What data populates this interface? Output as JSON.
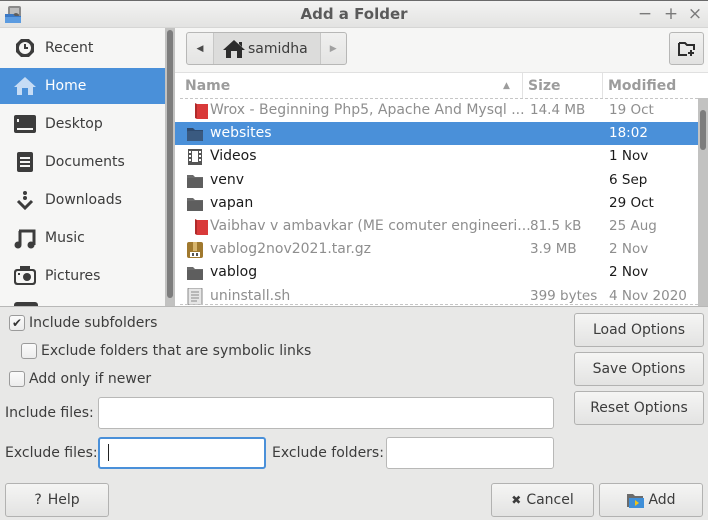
{
  "window": {
    "title": "Add a Folder",
    "controls": {
      "minimize": "−",
      "maximize": "+",
      "close": "×"
    }
  },
  "sidebar": {
    "items": [
      {
        "label": "Recent",
        "icon": "clock-icon",
        "active": false
      },
      {
        "label": "Home",
        "icon": "home-icon",
        "active": true
      },
      {
        "label": "Desktop",
        "icon": "desktop-icon",
        "active": false
      },
      {
        "label": "Documents",
        "icon": "documents-icon",
        "active": false
      },
      {
        "label": "Downloads",
        "icon": "downloads-icon",
        "active": false
      },
      {
        "label": "Music",
        "icon": "music-icon",
        "active": false
      },
      {
        "label": "Pictures",
        "icon": "camera-icon",
        "active": false
      }
    ]
  },
  "pathbar": {
    "back_arrow": "◀",
    "forward_arrow": "▶",
    "current": "samidha"
  },
  "filelist": {
    "columns": {
      "name": "Name",
      "size": "Size",
      "modified": "Modified"
    },
    "sort_indicator": "▲",
    "rows": [
      {
        "name": "Wrox - Beginning Php5, Apache And Mysql ...",
        "size": "14.4 MB",
        "modified": "19 Oct",
        "icon": "pdf-icon",
        "style": "dim"
      },
      {
        "name": "websites",
        "size": "",
        "modified": "18:02",
        "icon": "folder-icon",
        "style": "selected"
      },
      {
        "name": "Videos",
        "size": "",
        "modified": "1 Nov",
        "icon": "video-folder-icon",
        "style": "dark"
      },
      {
        "name": "venv",
        "size": "",
        "modified": "6 Sep",
        "icon": "folder-icon",
        "style": "dark"
      },
      {
        "name": "vapan",
        "size": "",
        "modified": "29 Oct",
        "icon": "folder-icon",
        "style": "dark"
      },
      {
        "name": "Vaibhav v ambavkar (ME comuter engineeri...",
        "size": "81.5 kB",
        "modified": "25 Aug",
        "icon": "pdf-icon",
        "style": "dim"
      },
      {
        "name": "vablog2nov2021.tar.gz",
        "size": "3.9 MB",
        "modified": "2 Nov",
        "icon": "archive-icon",
        "style": "dim"
      },
      {
        "name": "vablog",
        "size": "",
        "modified": "2 Nov",
        "icon": "folder-icon",
        "style": "dark"
      },
      {
        "name": "uninstall.sh",
        "size": "399 bytes",
        "modified": "4 Nov 2020",
        "icon": "script-icon",
        "style": "dim"
      }
    ]
  },
  "options": {
    "include_subfolders": {
      "label": "Include subfolders",
      "checked": true
    },
    "exclude_symlinks": {
      "label": "Exclude folders that are symbolic links",
      "checked": false
    },
    "add_only_newer": {
      "label": "Add only if newer",
      "checked": false
    },
    "include_files": {
      "label": "Include files:",
      "value": ""
    },
    "exclude_files": {
      "label": "Exclude files:",
      "value": ""
    },
    "exclude_folders": {
      "label": "Exclude folders:",
      "value": ""
    }
  },
  "buttons": {
    "load_options": "Load Options",
    "save_options": "Save Options",
    "reset_options": "Reset Options",
    "help": "Help",
    "help_glyph": "?",
    "cancel": "Cancel",
    "cancel_glyph": "✖",
    "add": "Add"
  },
  "colors": {
    "accent": "#4a90d9",
    "pdf_red": "#d93a3a",
    "folder_gray": "#6b6b6b"
  }
}
